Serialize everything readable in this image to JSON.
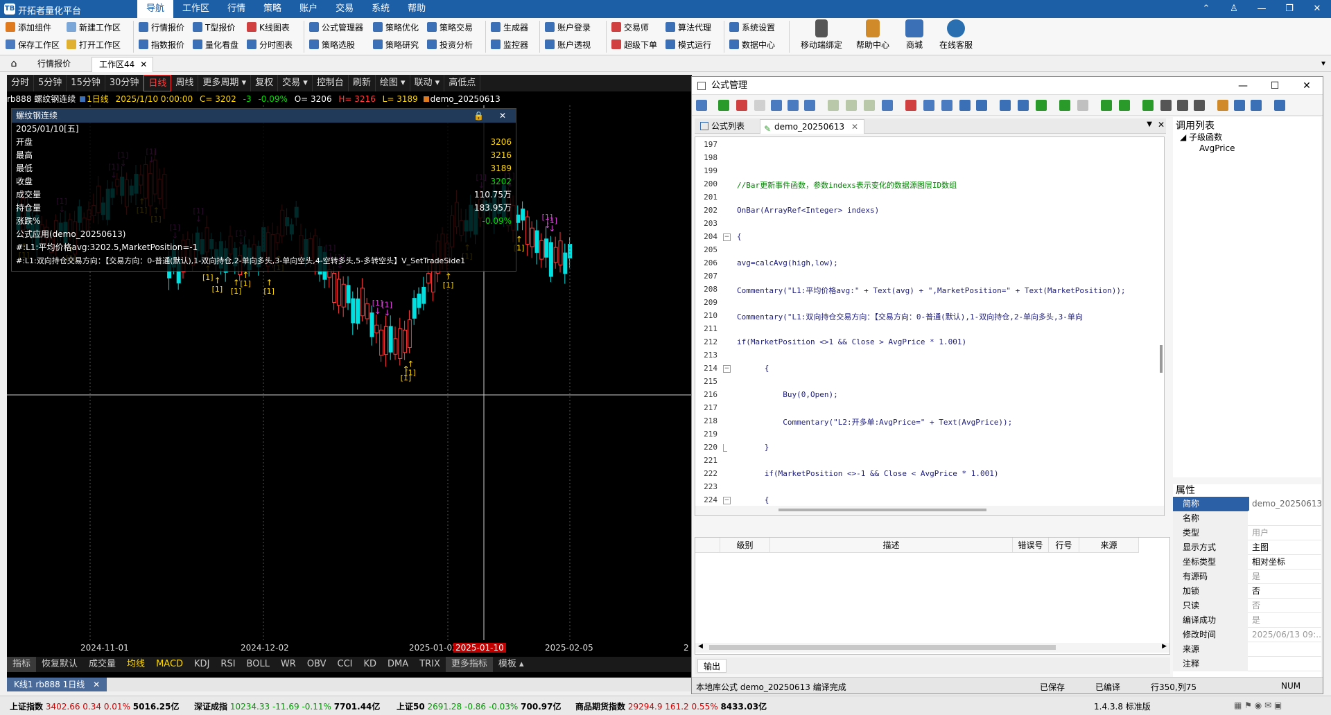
{
  "app": {
    "title": "开拓者量化平台"
  },
  "menu": [
    "导航",
    "工作区",
    "行情",
    "策略",
    "账户",
    "交易",
    "系统",
    "帮助"
  ],
  "ribbon": {
    "row1": [
      "添加组件",
      "新建工作区",
      "行情报价",
      "T型报价",
      "K线图表",
      "公式管理器",
      "策略优化",
      "策略交易",
      "生成器",
      "账户登录",
      "交易师",
      "算法代理",
      "系统设置"
    ],
    "row2": [
      "保存工作区",
      "打开工作区",
      "指数报价",
      "量化看盘",
      "分时图表",
      "策略选股",
      "策略研究",
      "投资分析",
      "监控器",
      "账户透视",
      "超级下单",
      "模式运行",
      "数据中心"
    ],
    "big": [
      "移动端绑定",
      "帮助中心",
      "商城",
      "在线客服"
    ]
  },
  "doc_tabs": [
    "行情报价",
    "工作区44"
  ],
  "chart": {
    "periods": [
      "分时",
      "5分钟",
      "15分钟",
      "30分钟",
      "日线",
      "周线",
      "更多周期",
      "复权",
      "交易",
      "控制台",
      "刷新",
      "绘图",
      "联动",
      "高低点"
    ],
    "selected_period": "日线",
    "info": {
      "symbol": "rb888 螺纹钢连续",
      "period": "1日线",
      "datetime": "2025/1/10 0:00:00",
      "close": "C= 3202",
      "change": "-3",
      "pct": "-0.09%",
      "open": "O= 3206",
      "high": "H= 3216",
      "low": "L= 3189",
      "formula": "demo_20250613"
    },
    "popup": {
      "title": "螺纹钢连续",
      "date": "2025/01/10[五]",
      "rows": [
        {
          "k": "开盘",
          "v": "3206"
        },
        {
          "k": "最高",
          "v": "3216"
        },
        {
          "k": "最低",
          "v": "3189"
        },
        {
          "k": "收盘",
          "v": "3202"
        },
        {
          "k": "成交量",
          "v": "110.75万"
        },
        {
          "k": "持仓量",
          "v": "183.95万"
        },
        {
          "k": "涨跌%",
          "v": "-0.09%"
        }
      ],
      "formula_line": "公式应用(demo_20250613)",
      "line1": "#:L1:平均价格avg:3202.5,MarketPosition=-1",
      "line2": "#:L1:双向持仓交易方向：【交易方向：0-普通(默认),1-双向持仓,2-单向多头,3-单向空头,4-空转多头,5-多转空头】V_SetTradeSide1"
    },
    "x_labels": [
      "2024-11-01",
      "2024-12-02",
      "2025-01-02",
      "2025-01-10",
      "2025-02-05",
      "2"
    ],
    "indicators": [
      "指标",
      "恢复默认",
      "成交量",
      "均线",
      "MACD",
      "KDJ",
      "RSI",
      "BOLL",
      "WR",
      "OBV",
      "CCI",
      "KD",
      "DMA",
      "TRIX",
      "更多指标",
      "模板"
    ],
    "sheet_tab": "K线1 rb888 1日线",
    "marker": "[1]"
  },
  "dialog": {
    "title": "公式管理",
    "tabs": [
      "公式列表",
      "demo_20250613"
    ],
    "code": [
      {
        "n": "197",
        "t": "",
        "c": "#1c1c7a"
      },
      {
        "n": "198",
        "t": "",
        "c": "#1c1c7a"
      },
      {
        "n": "199",
        "t": "",
        "c": "#1c1c7a"
      },
      {
        "n": "200",
        "t": "//Bar更新事件函数，参数indexs表示变化的数据源图层ID数组",
        "c": "#008000"
      },
      {
        "n": "201",
        "t": "",
        "c": "#1c1c7a"
      },
      {
        "n": "202",
        "t": "OnBar(ArrayRef<Integer> indexs)",
        "c": "#1c1c7a"
      },
      {
        "n": "203",
        "t": "",
        "c": "#1c1c7a"
      },
      {
        "n": "204",
        "t": "{",
        "c": "#1c1c7a"
      },
      {
        "n": "205",
        "t": "",
        "c": "#1c1c7a"
      },
      {
        "n": "206",
        "t": "avg=calcAvg(high,low);",
        "c": "#1c1c7a"
      },
      {
        "n": "207",
        "t": "",
        "c": "#1c1c7a"
      },
      {
        "n": "208",
        "t": "Commentary(\"L1:平均价格avg:\" + Text(avg) + \",MarketPosition=\" + Text(MarketPosition));",
        "c": "#1c1c7a"
      },
      {
        "n": "209",
        "t": "",
        "c": "#1c1c7a"
      },
      {
        "n": "210",
        "t": "Commentary(\"L1:双向持仓交易方向：【交易方向：0-普通(默认),1-双向持仓,2-单向多头,3-单向",
        "c": "#1c1c7a"
      },
      {
        "n": "211",
        "t": "",
        "c": "#1c1c7a"
      },
      {
        "n": "212",
        "t": "if(MarketPosition <>1 && Close > AvgPrice * 1.001)",
        "c": "#1c1c7a"
      },
      {
        "n": "213",
        "t": "",
        "c": "#1c1c7a"
      },
      {
        "n": "214",
        "t": "      {",
        "c": "#1c1c7a"
      },
      {
        "n": "215",
        "t": "",
        "c": "#1c1c7a"
      },
      {
        "n": "216",
        "t": "          Buy(0,Open);",
        "c": "#1c1c7a"
      },
      {
        "n": "217",
        "t": "",
        "c": "#1c1c7a"
      },
      {
        "n": "218",
        "t": "          Commentary(\"L2:开多单:AvgPrice=\" + Text(AvgPrice));",
        "c": "#1c1c7a"
      },
      {
        "n": "219",
        "t": "",
        "c": "#1c1c7a"
      },
      {
        "n": "220",
        "t": "      }",
        "c": "#1c1c7a"
      },
      {
        "n": "221",
        "t": "",
        "c": "#1c1c7a"
      },
      {
        "n": "222",
        "t": "      if(MarketPosition <>-1 && Close < AvgPrice * 1.001)",
        "c": "#1c1c7a"
      },
      {
        "n": "223",
        "t": "",
        "c": "#1c1c7a"
      },
      {
        "n": "224",
        "t": "      {",
        "c": "#1c1c7a"
      },
      {
        "n": "225",
        "t": "",
        "c": "#1c1c7a"
      }
    ],
    "call_list": {
      "title": "调用列表",
      "group": "子级函数",
      "item": "AvgPrice"
    },
    "props": {
      "title": "属性",
      "rows": [
        {
          "k": "简称",
          "v": "demo_20250613"
        },
        {
          "k": "名称",
          "v": ""
        },
        {
          "k": "类型",
          "v": "用户"
        },
        {
          "k": "显示方式",
          "v": "主图"
        },
        {
          "k": "坐标类型",
          "v": "相对坐标"
        },
        {
          "k": "有源码",
          "v": "是"
        },
        {
          "k": "加锁",
          "v": "否"
        },
        {
          "k": "只读",
          "v": "否"
        },
        {
          "k": "编译成功",
          "v": "是"
        },
        {
          "k": "修改时间",
          "v": "2025/06/13 09:..."
        },
        {
          "k": "来源",
          "v": ""
        },
        {
          "k": "注释",
          "v": ""
        }
      ]
    },
    "err_headers": [
      "级别",
      "描述",
      "错误号",
      "行号",
      "来源"
    ],
    "output_tab": "输出",
    "status": {
      "msg": "本地库公式 demo_20250613 编译完成",
      "saved": "已保存",
      "compiled": "已编译",
      "pos": "行350,列75",
      "num": "NUM"
    }
  },
  "statusbar": [
    {
      "name": "上证指数",
      "price": "3402.66",
      "chg": "0.34",
      "pct": "0.01%",
      "amt": "5016.25亿",
      "dir": "up"
    },
    {
      "name": "深证成指",
      "price": "10234.33",
      "chg": "-11.69",
      "pct": "-0.11%",
      "amt": "7701.44亿",
      "dir": "dn"
    },
    {
      "name": "上证50",
      "price": "2691.28",
      "chg": "-0.86",
      "pct": "-0.03%",
      "amt": "700.97亿",
      "dir": "dn"
    },
    {
      "name": "商品期货指数",
      "price": "29294.9",
      "chg": "161.2",
      "pct": "0.55%",
      "amt": "8433.03亿",
      "dir": "up"
    }
  ],
  "version": "1.4.3.8 标准版",
  "colors": {
    "brand": "#1d5fa6",
    "up_candle": "#ff3b3b",
    "down_candle": "#00e0e0",
    "signal_buy": "#ffd700",
    "signal_sell": "#e040e0"
  }
}
